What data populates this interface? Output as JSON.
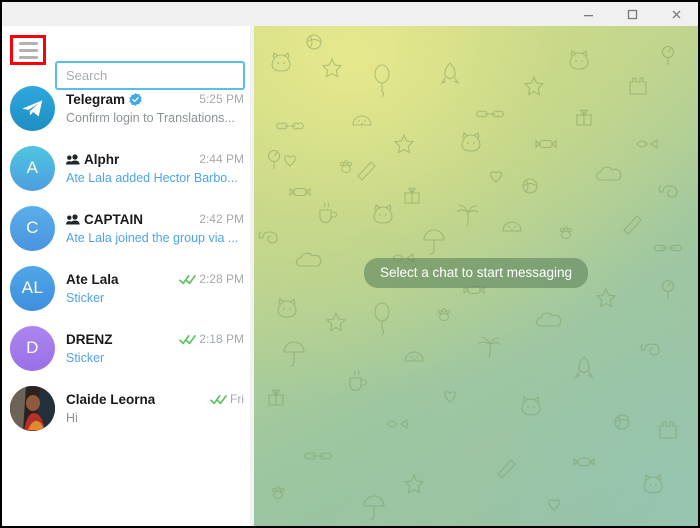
{
  "window": {
    "controls": [
      {
        "name": "minimize",
        "label": "—"
      },
      {
        "name": "maximize",
        "label": "□"
      },
      {
        "name": "close",
        "label": "✕"
      }
    ]
  },
  "sidebar": {
    "menu_button": {
      "icon": "hamburger-menu-icon",
      "highlight_color": "#fb0007"
    },
    "search": {
      "placeholder": "Search",
      "value": "",
      "border_color": "#56bfeb"
    },
    "chats": [
      {
        "name": "Telegram",
        "avatar_text": "",
        "avatar_kind": "telegram-logo",
        "verified": true,
        "group": false,
        "time": "5:25 PM",
        "read_status": "",
        "message": "Confirm login to Translations...",
        "message_is_link": false
      },
      {
        "name": "Alphr",
        "avatar_text": "A",
        "avatar_kind": "letter",
        "verified": false,
        "group": true,
        "time": "2:44 PM",
        "read_status": "",
        "message": "Ate Lala added Hector Barbo...",
        "message_is_link": true
      },
      {
        "name": "CAPTAIN",
        "avatar_text": "C",
        "avatar_kind": "letter",
        "verified": false,
        "group": true,
        "time": "2:42 PM",
        "read_status": "",
        "message": "Ate Lala joined the group via ...",
        "message_is_link": true
      },
      {
        "name": "Ate Lala",
        "avatar_text": "AL",
        "avatar_kind": "letter",
        "verified": false,
        "group": false,
        "time": "2:28 PM",
        "read_status": "read",
        "message": "Sticker",
        "message_is_link": true
      },
      {
        "name": "DRENZ",
        "avatar_text": "D",
        "avatar_kind": "letter",
        "verified": false,
        "group": false,
        "time": "2:18 PM",
        "read_status": "read",
        "message": "Sticker",
        "message_is_link": true
      },
      {
        "name": "Claide Leorna",
        "avatar_text": "",
        "avatar_kind": "photo",
        "verified": false,
        "group": false,
        "time": "Fri",
        "read_status": "read",
        "message": "Hi",
        "message_is_link": false
      }
    ]
  },
  "chat_pane": {
    "placeholder_text": "Select a chat to start messaging"
  }
}
